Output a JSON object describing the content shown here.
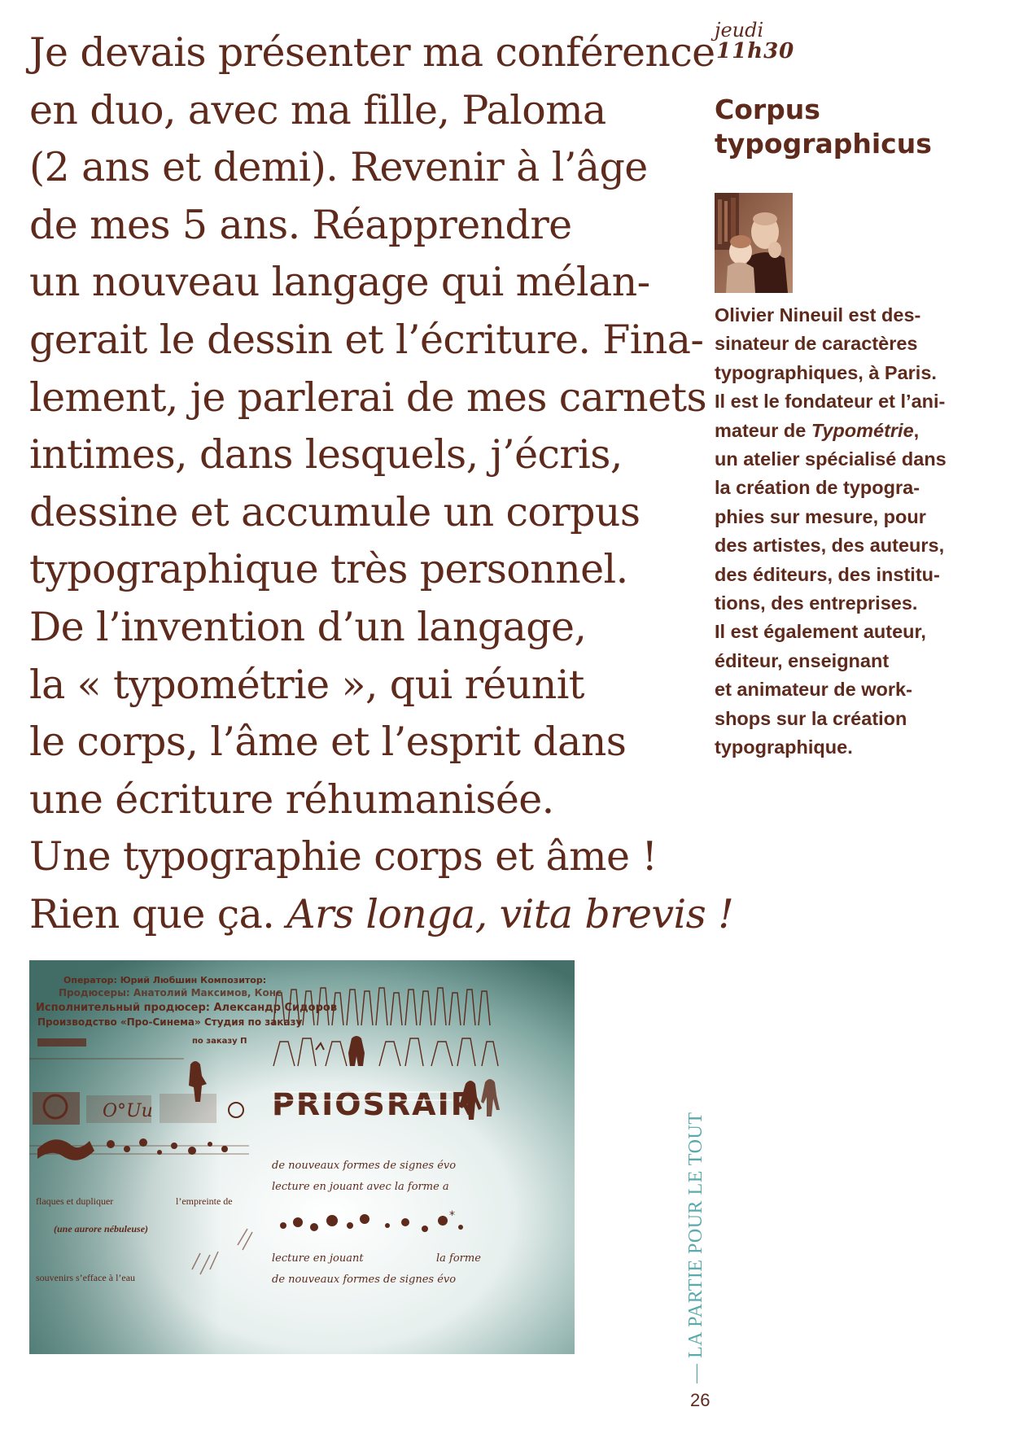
{
  "main_text": {
    "lines": [
      "Je devais présenter ma conférence",
      "en duo, avec ma fille, Paloma",
      "(2 ans et demi). Revenir à l’âge",
      "de mes 5 ans. Réapprendre",
      "un nouveau langage qui mélan-",
      "gerait le dessin et l’écriture. Fina-",
      "lement, je parlerai de mes carnets",
      "intimes, dans lesquels, j’écris,",
      "dessine et accumule un corpus",
      "typographique très personnel.",
      "De l’invention d’un langage,",
      "la « typométrie », qui réunit",
      "le corps, l’âme et l’esprit dans",
      "une écriture réhumanisée.",
      "Une typographie corps et âme !"
    ],
    "last_line_plain": "Rien que ça. ",
    "last_line_italic": "Ars longa, vita brevis !"
  },
  "sidebar": {
    "day": "jeudi",
    "time": "11h30",
    "title_line1": "Corpus",
    "title_line2": "typographicus",
    "bio_lines": [
      "Olivier Nineuil est des-",
      "sinateur de caractères",
      "typographiques, à Paris.",
      "Il est le fondateur et l’ani-"
    ],
    "bio_mateur_prefix": "mateur de ",
    "bio_mateur_italic": "Typométrie",
    "bio_mateur_suffix": ",",
    "bio_lines_after": [
      "un atelier spécialisé dans",
      "la création de typogra-",
      "phies sur mesure, pour",
      "des artistes, des auteurs,",
      "des éditeurs, des institu-",
      "tions, des entreprises.",
      "Il est également auteur,",
      "éditeur, enseignant",
      "et animateur de work-",
      "shops sur la création",
      "typographique."
    ]
  },
  "specimen": {
    "headline_1": "Оператор: Юрий Любшин Композитор:",
    "headline_2": "Продюсеры: Анатолий Максимов, Конс",
    "headline_3": "Исполнительный продюсер: Александр Сидоров",
    "headline_4": "Производство «Про-Синема» Студия по заказу",
    "headline_5": "по заказу П",
    "caption_left_1": "flaques et dupliquer",
    "caption_left_2": "l’empreinte de",
    "caption_left_3": "(une aurore nébuleuse)",
    "caption_left_4": "souvenirs s’efface à l’eau",
    "caption_right_1": "de nouveaux formes de signes évo",
    "caption_right_2": "lecture en jouant avec la forme a",
    "caption_right_3": "lecture en jouant",
    "caption_right_4": "la forme",
    "caption_right_5": "de nouveaux formes de signes évo",
    "stencil_text": "PRIOSRAIR",
    "colors": {
      "teal": "#3f6f68",
      "brown": "#5e2a1c"
    }
  },
  "footer": {
    "running_head": "— LA PARTIE POUR LE TOUT",
    "page_number": "26"
  }
}
